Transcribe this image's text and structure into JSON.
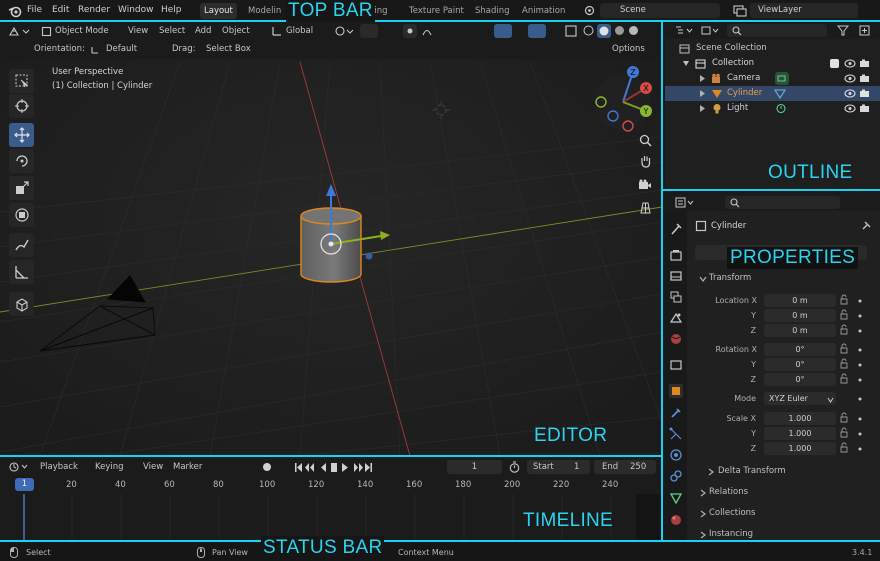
{
  "topbar": {
    "menus": [
      "File",
      "Edit",
      "Render",
      "Window",
      "Help"
    ],
    "workspaces": [
      "Layout",
      "Modelin",
      "ting",
      "Texture Paint",
      "Shading",
      "Animation"
    ],
    "scene": "Scene",
    "view_layer": "ViewLayer"
  },
  "viewport": {
    "mode": "Object Mode",
    "menus": [
      "View",
      "Select",
      "Add",
      "Object"
    ],
    "transform_orientation": "Global",
    "orientation_label": "Orientation:",
    "orientation_value": "Default",
    "drag_label": "Drag:",
    "drag_value": "Select Box",
    "options": "Options",
    "overlay_line1": "User Perspective",
    "overlay_line2": "(1) Collection | Cylinder",
    "gizmo_axes": {
      "x": "X",
      "y": "Y",
      "z": "Z"
    }
  },
  "outliner": {
    "root": "Scene Collection",
    "items": [
      {
        "label": "Collection",
        "depth": 1
      },
      {
        "label": "Camera",
        "depth": 2
      },
      {
        "label": "Cylinder",
        "depth": 2,
        "selected": true
      },
      {
        "label": "Light",
        "depth": 2
      }
    ]
  },
  "properties": {
    "object_name": "Cylinder",
    "transform_section": "Transform",
    "location": {
      "label": "Location X",
      "x": "0 m",
      "y": "0 m",
      "z": "0 m"
    },
    "rotation": {
      "label": "Rotation X",
      "x": "0°",
      "y": "0°",
      "z": "0°"
    },
    "mode_label": "Mode",
    "mode_value": "XYZ Euler",
    "scale": {
      "label": "Scale X",
      "x": "1.000",
      "y": "1.000",
      "z": "1.000"
    },
    "axis_y": "Y",
    "axis_z": "Z",
    "sections": [
      "Delta Transform",
      "Relations",
      "Collections",
      "Instancing"
    ]
  },
  "timeline": {
    "menus": [
      "Playback",
      "Keying",
      "View",
      "Marker"
    ],
    "current_frame": "1",
    "start_label": "Start",
    "start": "1",
    "end_label": "End",
    "end": "250",
    "frame_marker": "1",
    "ticks": [
      "20",
      "40",
      "60",
      "80",
      "100",
      "120",
      "140",
      "160",
      "180",
      "200",
      "220",
      "240"
    ]
  },
  "statusbar": {
    "select": "Select",
    "pan": "Pan View",
    "context": "Context Menu",
    "version": "3.4.1"
  },
  "overlay_labels": {
    "top_bar": "TOP BAR",
    "outline": "OUTLINE",
    "properties": "PROPERTIES",
    "editor": "EDITOR",
    "timeline": "TIMELINE",
    "status_bar": "STATUS BAR"
  },
  "colors": {
    "accent_cyan": "#19d2ef",
    "selection_blue": "#334766",
    "active_tool": "#3a5c8c",
    "object_orange": "#e0871f"
  }
}
